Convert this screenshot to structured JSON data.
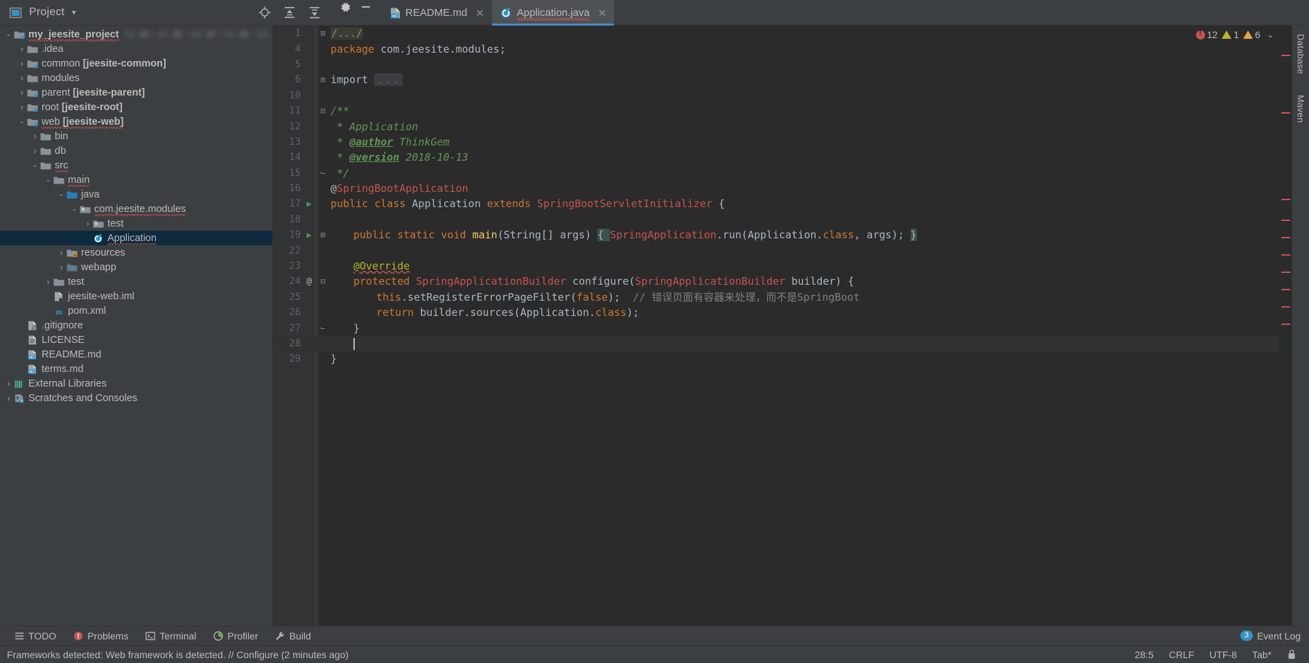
{
  "project_panel": {
    "title": "Project",
    "icons": [
      "locate-icon",
      "expand-all-icon",
      "collapse-all-icon"
    ],
    "settings_icon": "gear-icon",
    "minimize_icon": "minimize-icon"
  },
  "tree": [
    {
      "label": "my_jeesite_project",
      "bold": true,
      "depth": 0,
      "arrow": "down",
      "icon": "module-folder-icon",
      "spell": true,
      "trailing_blur": true
    },
    {
      "label": ".idea",
      "depth": 1,
      "arrow": "right",
      "icon": "folder-icon"
    },
    {
      "label": "common ",
      "bold_suffix": "[jeesite-common]",
      "depth": 1,
      "arrow": "right",
      "icon": "module-folder-icon"
    },
    {
      "label": "modules",
      "depth": 1,
      "arrow": "right",
      "icon": "folder-icon"
    },
    {
      "label": "parent ",
      "bold_suffix": "[jeesite-parent]",
      "depth": 1,
      "arrow": "right",
      "icon": "module-folder-icon"
    },
    {
      "label": "root ",
      "bold_suffix": "[jeesite-root]",
      "depth": 1,
      "arrow": "right",
      "icon": "module-folder-icon"
    },
    {
      "label": "web ",
      "bold_suffix": "[jeesite-web]",
      "depth": 1,
      "arrow": "down",
      "icon": "module-folder-icon",
      "spell": true
    },
    {
      "label": "bin",
      "depth": 2,
      "arrow": "right",
      "icon": "folder-icon"
    },
    {
      "label": "db",
      "depth": 2,
      "arrow": "right",
      "icon": "folder-icon"
    },
    {
      "label": "src",
      "depth": 2,
      "arrow": "down",
      "icon": "folder-icon",
      "spell": true
    },
    {
      "label": "main",
      "depth": 3,
      "arrow": "down",
      "icon": "folder-icon",
      "spell": true
    },
    {
      "label": "java",
      "depth": 4,
      "arrow": "down",
      "icon": "source-root-icon"
    },
    {
      "label": "com.jeesite.modules",
      "depth": 5,
      "arrow": "down",
      "icon": "package-icon",
      "spell": true
    },
    {
      "label": "test",
      "depth": 6,
      "arrow": "right",
      "icon": "package-icon"
    },
    {
      "label": "Application",
      "depth": 6,
      "arrow": "none",
      "icon": "spring-class-icon",
      "selected": true,
      "spell": true
    },
    {
      "label": "resources",
      "depth": 4,
      "arrow": "right",
      "icon": "resource-root-icon"
    },
    {
      "label": "webapp",
      "depth": 4,
      "arrow": "right",
      "icon": "webapp-root-icon"
    },
    {
      "label": "test",
      "depth": 3,
      "arrow": "right",
      "icon": "folder-icon"
    },
    {
      "label": "jeesite-web.iml",
      "depth": 3,
      "arrow": "none",
      "icon": "iml-file-icon"
    },
    {
      "label": "pom.xml",
      "depth": 3,
      "arrow": "none",
      "icon": "maven-file-icon"
    },
    {
      "label": ".gitignore",
      "depth": 1,
      "arrow": "none",
      "icon": "gitignore-file-icon"
    },
    {
      "label": "LICENSE",
      "depth": 1,
      "arrow": "none",
      "icon": "text-file-icon"
    },
    {
      "label": "README.md",
      "depth": 1,
      "arrow": "none",
      "icon": "markdown-file-icon"
    },
    {
      "label": "terms.md",
      "depth": 1,
      "arrow": "none",
      "icon": "markdown-file-icon"
    },
    {
      "label": "External Libraries",
      "depth": 0,
      "arrow": "right",
      "icon": "libraries-icon"
    },
    {
      "label": "Scratches and Consoles",
      "depth": 0,
      "arrow": "right",
      "icon": "scratches-icon"
    }
  ],
  "tabs": [
    {
      "label": "README.md",
      "icon": "markdown-file-icon",
      "active": false,
      "closable": true
    },
    {
      "label": "Application.java",
      "icon": "spring-class-icon",
      "active": true,
      "closable": true,
      "spell": true
    }
  ],
  "inspections": {
    "errors": "12",
    "warnings": "1",
    "weak_warnings": "6",
    "chevron": "chevron-down-icon"
  },
  "code": {
    "lines": [
      {
        "num": "1",
        "fold": "plus",
        "segments": [
          {
            "t": "/.../",
            "c": "fold-ph"
          }
        ]
      },
      {
        "num": "4",
        "segments": [
          {
            "t": "package ",
            "c": "kw"
          },
          {
            "t": "com.jeesite.modules;",
            "c": "pkg"
          }
        ]
      },
      {
        "num": "5",
        "segments": []
      },
      {
        "num": "6",
        "fold": "plus",
        "segments": [
          {
            "t": "import ",
            "c": "cls"
          },
          {
            "t": "...",
            "c": "fold-ph2"
          }
        ]
      },
      {
        "num": "10",
        "segments": []
      },
      {
        "num": "11",
        "fold": "open",
        "segments": [
          {
            "t": "/**",
            "c": "cmt"
          }
        ]
      },
      {
        "num": "12",
        "segments": [
          {
            "t": " * Application",
            "c": "cmt"
          }
        ]
      },
      {
        "num": "13",
        "segments": [
          {
            "t": " * ",
            "c": "cmt"
          },
          {
            "t": "@author",
            "c": "cmt-tag"
          },
          {
            "t": " ThinkGem",
            "c": "cmt"
          }
        ]
      },
      {
        "num": "14",
        "segments": [
          {
            "t": " * ",
            "c": "cmt"
          },
          {
            "t": "@version",
            "c": "cmt-tag"
          },
          {
            "t": " 2018-10-13",
            "c": "cmt"
          }
        ]
      },
      {
        "num": "15",
        "fold": "close",
        "segments": [
          {
            "t": " */",
            "c": "cmt"
          }
        ]
      },
      {
        "num": "16",
        "segments": [
          {
            "t": "@",
            "c": "cls"
          },
          {
            "t": "SpringBootApplication",
            "c": "anno-red"
          }
        ]
      },
      {
        "num": "17",
        "run": true,
        "segments": [
          {
            "t": "public class ",
            "c": "kw"
          },
          {
            "t": "Application ",
            "c": "cls"
          },
          {
            "t": "extends ",
            "c": "kw"
          },
          {
            "t": "SpringBootServletInitializer",
            "c": "type-red"
          },
          {
            "t": " {",
            "c": "cls"
          }
        ]
      },
      {
        "num": "18",
        "segments": []
      },
      {
        "num": "19",
        "run": true,
        "fold": "plus",
        "indent": 1,
        "segments": [
          {
            "t": "public static ",
            "c": "kw"
          },
          {
            "t": "void ",
            "c": "kw"
          },
          {
            "t": "main",
            "c": "fn"
          },
          {
            "t": "(String[] args) ",
            "c": "cls"
          },
          {
            "t": "{ ",
            "c": "brace-hl"
          },
          {
            "t": "SpringApplication",
            "c": "type-red"
          },
          {
            "t": ".run(Application.",
            "c": "cls"
          },
          {
            "t": "class",
            "c": "kw"
          },
          {
            "t": ", args); ",
            "c": "cls"
          },
          {
            "t": "}",
            "c": "brace-hl"
          }
        ]
      },
      {
        "num": "22",
        "segments": []
      },
      {
        "num": "23",
        "indent": 1,
        "segments": [
          {
            "t": "@Override",
            "c": "anno err-ul"
          }
        ]
      },
      {
        "num": "24",
        "at": true,
        "fold": "open",
        "indent": 1,
        "segments": [
          {
            "t": "protected ",
            "c": "kw"
          },
          {
            "t": "SpringApplicationBuilder",
            "c": "type-red"
          },
          {
            "t": " configure(",
            "c": "cls"
          },
          {
            "t": "SpringApplicationBuilder",
            "c": "type-red"
          },
          {
            "t": " builder) {",
            "c": "cls"
          }
        ]
      },
      {
        "num": "25",
        "indent": 2,
        "warn": true,
        "segments": [
          {
            "t": "this",
            "c": "kw"
          },
          {
            "t": ".setRegisterErrorPageFilter(",
            "c": "cls"
          },
          {
            "t": "false",
            "c": "kw"
          },
          {
            "t": ");  ",
            "c": "cls"
          },
          {
            "t": "// 错误页面有容器来处理，而不是SpringBoot",
            "c": "linecmt"
          }
        ]
      },
      {
        "num": "26",
        "indent": 2,
        "segments": [
          {
            "t": "return ",
            "c": "kw"
          },
          {
            "t": "builder.sources(Application.",
            "c": "cls"
          },
          {
            "t": "class",
            "c": "kw"
          },
          {
            "t": ");",
            "c": "cls"
          }
        ]
      },
      {
        "num": "27",
        "fold": "close",
        "indent": 1,
        "segments": [
          {
            "t": "}",
            "c": "cls"
          }
        ]
      },
      {
        "num": "28",
        "current": true,
        "indent": 1,
        "caret": true,
        "segments": []
      },
      {
        "num": "29",
        "segments": [
          {
            "t": "}",
            "c": "cls"
          }
        ]
      }
    ]
  },
  "right_strip": [
    "Database",
    "Maven"
  ],
  "bottom_toolbar": [
    {
      "label": "TODO",
      "icon": "todo-icon"
    },
    {
      "label": "Problems",
      "icon": "problems-icon"
    },
    {
      "label": "Terminal",
      "icon": "terminal-icon"
    },
    {
      "label": "Profiler",
      "icon": "profiler-icon"
    },
    {
      "label": "Build",
      "icon": "build-icon"
    }
  ],
  "event_log": {
    "label": "Event Log",
    "count": "3"
  },
  "status_bar": {
    "message": "Frameworks detected: Web framework is detected. // Configure (2 minutes ago)",
    "position": "28:5",
    "line_sep": "CRLF",
    "encoding": "UTF-8",
    "indent": "Tab*",
    "lock_icon": "lock-icon"
  },
  "colors": {
    "accent": "#4a88c7",
    "selection": "#0d293e",
    "editor_bg": "#2b2b2b",
    "panel_bg": "#3c3f41",
    "error": "#c75450",
    "warning": "#bbb529"
  }
}
